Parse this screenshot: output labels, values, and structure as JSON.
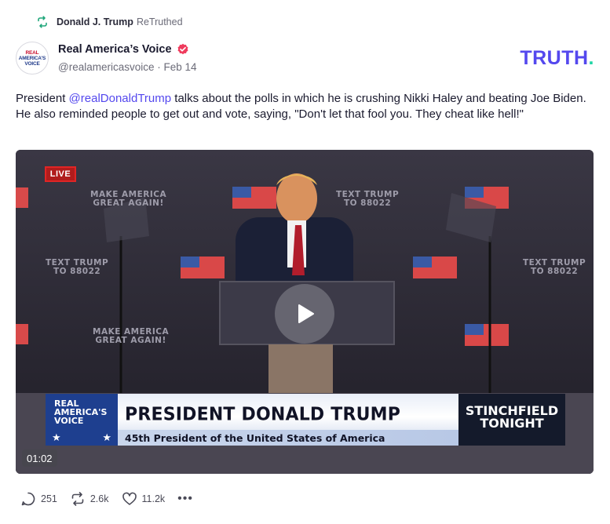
{
  "retruth": {
    "icon": "retruth-icon",
    "name": "Donald J. Trump",
    "suffix": "ReTruthed"
  },
  "author": {
    "avatar_icon": "real-americas-voice-logo",
    "avatar_line1": "REAL",
    "avatar_line2": "AMERICA'S",
    "avatar_line3": "VOICE",
    "name": "Real America’s Voice",
    "verified_icon": "verified-badge-icon",
    "meta": "@realamericasvoice · Feb 14"
  },
  "brand": {
    "logo_text": "TRUTH",
    "logo_dot": ".",
    "color": "#5448ee",
    "dot_color": "#1fd6a6"
  },
  "post": {
    "text_prefix": "President ",
    "mention": "@realDonaldTrump",
    "text_suffix": " talks about the polls in which he is crushing Nikki Haley and beating Joe Biden. He also reminded people to get out and vote, saying, \"Don't let that fool you. They cheat like hell!\""
  },
  "video": {
    "live_label": "LIVE",
    "bg_make_america_1": "MAKE AMERICA",
    "bg_great_again_1": "GREAT AGAIN!",
    "bg_text_trump_1": "TEXT TRUMP",
    "bg_number_1": "TO 88022",
    "bg_text_trump_2": "TEXT TRUMP",
    "bg_number_2": "TO 88022",
    "bg_text_trump_3": "TEXT TRUMP",
    "bg_number_3": "TO 88022",
    "bg_make_america_2": "MAKE AMERICA",
    "bg_great_again_2": "GREAT AGAIN!",
    "play_icon": "play-icon",
    "lower_third": {
      "logo_line1": "REAL",
      "logo_line2": "AMERICA'S",
      "logo_line3": "VOICE",
      "title": "PRESIDENT DONALD TRUMP",
      "subtitle": "45th President of the United States of America",
      "show_line1": "STINCHFIELD",
      "show_line2": "TONIGHT"
    },
    "duration": "01:02"
  },
  "actions": {
    "replies_icon": "reply-icon",
    "replies": "251",
    "retruths_icon": "retruth-icon",
    "retruths": "2.6k",
    "likes_icon": "heart-icon",
    "likes": "11.2k",
    "more_icon": "more-icon",
    "more": "•••"
  }
}
